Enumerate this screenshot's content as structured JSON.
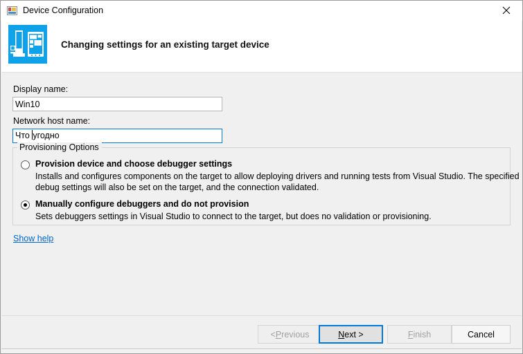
{
  "window": {
    "title": "Device Configuration",
    "title_icon": "device-config-icon",
    "close_label": "×"
  },
  "header": {
    "icon": "pc-and-tablet-icon",
    "title": "Changing settings for an existing target device"
  },
  "form": {
    "display_name": {
      "label": "Display name:",
      "value": "Win10",
      "placeholder": ""
    },
    "network_host_name": {
      "label": "Network host name:",
      "value_before_caret": "Что ",
      "value_after_caret": "угодно",
      "value": "Что угодно",
      "placeholder": ""
    }
  },
  "provisioning": {
    "group_title": "Provisioning Options",
    "options": [
      {
        "label": "Provision device and choose debugger settings",
        "description": "Installs and configures components on the target to allow deploying drivers and running tests from Visual Studio. The specified debug settings will also be set on the target, and the connection validated.",
        "selected": false
      },
      {
        "label": "Manually configure debuggers and do not provision",
        "description": "Sets debuggers settings in Visual Studio to connect to the target, but does no validation or provisioning.",
        "selected": true
      }
    ]
  },
  "help": {
    "link_label": "Show help"
  },
  "footer": {
    "buttons": [
      {
        "label": "< Previous",
        "state": "disabled",
        "accel_index": 2
      },
      {
        "label": "Next >",
        "state": "default",
        "accel_index": 0
      },
      {
        "label": "Finish",
        "state": "disabled",
        "accel_index": 0
      },
      {
        "label": "Cancel",
        "state": "enabled",
        "accel_index": -1
      }
    ],
    "previous_pre": "< ",
    "previous_accel": "P",
    "previous_post": "revious",
    "next_accel": "N",
    "next_post": "ext >",
    "finish_accel": "F",
    "finish_post": "inish",
    "cancel_label": "Cancel"
  },
  "colors": {
    "accent": "#0078d7",
    "header_icon": "#0fa2e8",
    "link": "#0066cc",
    "body_bg": "#f0f0f0",
    "header_bg": "#ffffff"
  }
}
